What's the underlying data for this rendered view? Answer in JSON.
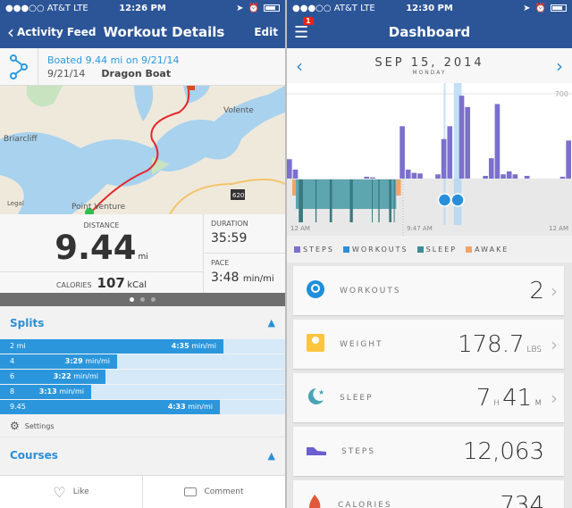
{
  "left": {
    "status": {
      "carrier": "●●●○○ AT&T  LTE",
      "time": "12:26 PM"
    },
    "nav": {
      "back": "Activity Feed",
      "title": "Workout Details",
      "edit": "Edit"
    },
    "header": {
      "title": "Boated 9.44 mi on 9/21/14",
      "date": "9/21/14",
      "activity": "Dragon Boat"
    },
    "map": {
      "labels": [
        "Volente",
        "Briarcliff",
        "Point Venture",
        "Legal",
        "620"
      ]
    },
    "stats": {
      "distance_label": "DISTANCE",
      "distance": "9.44",
      "distance_unit": "mi",
      "calories_label": "CALORIES",
      "calories": "107",
      "calories_unit": "kCal",
      "duration_label": "DURATION",
      "duration": "35:59",
      "pace_label": "PACE",
      "pace": "3:48",
      "pace_unit": "min/mi"
    },
    "pager": {
      "pages": 3,
      "current": 1
    },
    "splits": {
      "title": "Splits",
      "rows": [
        {
          "mile": "2 mi",
          "pace": "4:35",
          "unit": "min/mi",
          "fraction": 0.785
        },
        {
          "mile": "4",
          "pace": "3:29",
          "unit": "min/mi",
          "fraction": 0.41
        },
        {
          "mile": "6",
          "pace": "3:22",
          "unit": "min/mi",
          "fraction": 0.37
        },
        {
          "mile": "8",
          "pace": "3:13",
          "unit": "min/mi",
          "fraction": 0.32
        },
        {
          "mile": "9.45",
          "pace": "4:33",
          "unit": "min/mi",
          "fraction": 0.77
        }
      ],
      "settings": "Settings"
    },
    "courses": {
      "title": "Courses"
    },
    "actions": {
      "like": "Like",
      "comment": "Comment"
    }
  },
  "right": {
    "status": {
      "carrier": "●●●○○ AT&T  LTE",
      "time": "12:30 PM"
    },
    "nav": {
      "title": "Dashboard",
      "badge": "1"
    },
    "date": {
      "date": "SEP 15, 2014",
      "weekday": "MONDAY"
    },
    "chart_data": {
      "type": "bar",
      "y_gridline": 700,
      "y_gridline_label": "700",
      "x_ticks": [
        "12 AM",
        "9:47 AM",
        "12 AM"
      ],
      "steps_per_half_hour": {
        "slots": [
          0,
          1,
          13,
          14,
          19,
          20,
          21,
          22,
          25,
          26,
          27,
          29,
          30,
          33,
          34,
          35,
          36,
          37,
          38,
          40,
          46,
          47
        ],
        "values": [
          160,
          74,
          15,
          10,
          432,
          74,
          47,
          42,
          35,
          326,
          432,
          684,
          590,
          22,
          168,
          615,
          35,
          59,
          35,
          22,
          15,
          314
        ]
      },
      "sleep_hours": [
        [
          0.75,
          9.2
        ]
      ],
      "deep_sleep_hours": [
        [
          1.0,
          1.35
        ],
        [
          2.4,
          2.5
        ],
        [
          3.6,
          3.8
        ],
        [
          5.3,
          5.55
        ],
        [
          7.15,
          7.2
        ],
        [
          7.7,
          7.8
        ],
        [
          8.6,
          8.8
        ],
        [
          9.0,
          9.05
        ]
      ],
      "awake_hours": [
        [
          0.45,
          0.75
        ],
        [
          9.2,
          9.6
        ]
      ],
      "workout_hours": [
        [
          13.2,
          13.35
        ],
        [
          14.05,
          14.7
        ]
      ],
      "legend": [
        {
          "name": "STEPS",
          "color": "#7b70cc"
        },
        {
          "name": "WORKOUTS",
          "color": "#2a8fd8"
        },
        {
          "name": "SLEEP",
          "color": "#3f8c96"
        },
        {
          "name": "AWAKE",
          "color": "#f4a466"
        }
      ]
    },
    "cards": [
      {
        "label": "WORKOUTS",
        "value": "2",
        "icon": "workout-icon",
        "arrow": true
      },
      {
        "label": "WEIGHT",
        "value": "178.7",
        "unit": "LBS",
        "icon": "scale-icon",
        "arrow": true
      },
      {
        "label": "SLEEP",
        "value": "7",
        "unit": "H",
        "value2": "41",
        "unit2": "M",
        "icon": "moon-icon",
        "arrow": true
      },
      {
        "label": "STEPS",
        "value": "12,063",
        "icon": "shoe-icon",
        "arrow": false
      },
      {
        "label": "CALORIES",
        "value": "734",
        "icon": "flame-icon",
        "arrow": false
      }
    ]
  }
}
